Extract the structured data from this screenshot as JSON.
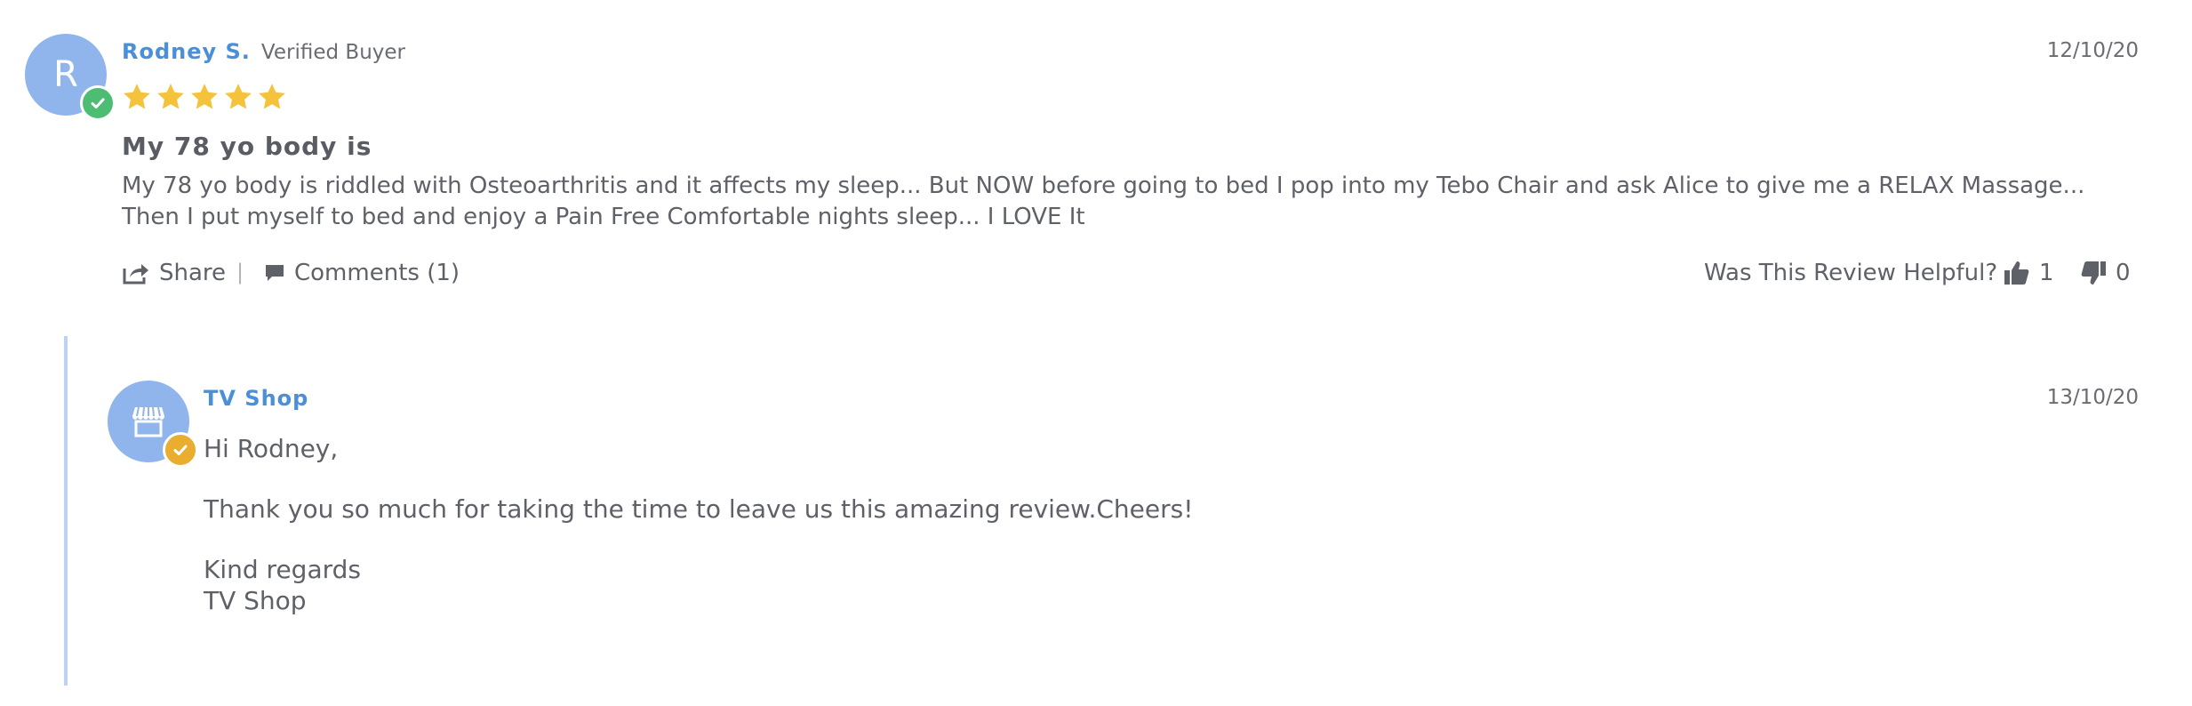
{
  "review": {
    "avatar_letter": "R",
    "author": "Rodney S.",
    "verified_label": "Verified Buyer",
    "date": "12/10/20",
    "rating": 5,
    "rating_max": 5,
    "title": "My 78 yo body is",
    "body_line1": "My 78 yo body is riddled with Osteoarthritis and it affects my sleep... But NOW before going to bed I pop into my Tebo Chair and ask Alice to give me a RELAX Massage...",
    "body_line2": "Then I put myself to bed and enjoy a Pain Free Comfortable nights sleep... I LOVE It",
    "share_label": "Share",
    "separator": "|",
    "comments_label": "Comments (1)",
    "helpful_label": "Was This Review Helpful?",
    "upvotes": "1",
    "downvotes": "0"
  },
  "reply": {
    "author": "TV Shop",
    "date": "13/10/20",
    "greeting": "Hi Rodney,",
    "message": "Thank you so much for taking the time to leave us this amazing review.Cheers!",
    "signoff": "Kind regards",
    "signature": "TV Shop"
  },
  "colors": {
    "accent": "#4a8fd9",
    "avatar": "#8fb5ec",
    "verified_badge": "#4dbd74",
    "shop_badge": "#e9ad2f",
    "star": "#f5c33b",
    "reply_bar": "#bcd3f2"
  },
  "icons": {
    "verified_badge": "check-circle-icon",
    "shop_avatar": "storefront-icon",
    "shop_badge": "check-circle-icon",
    "star": "star-icon",
    "share": "share-icon",
    "comments": "comment-icon",
    "thumbs_up": "thumbs-up-icon",
    "thumbs_down": "thumbs-down-icon"
  }
}
